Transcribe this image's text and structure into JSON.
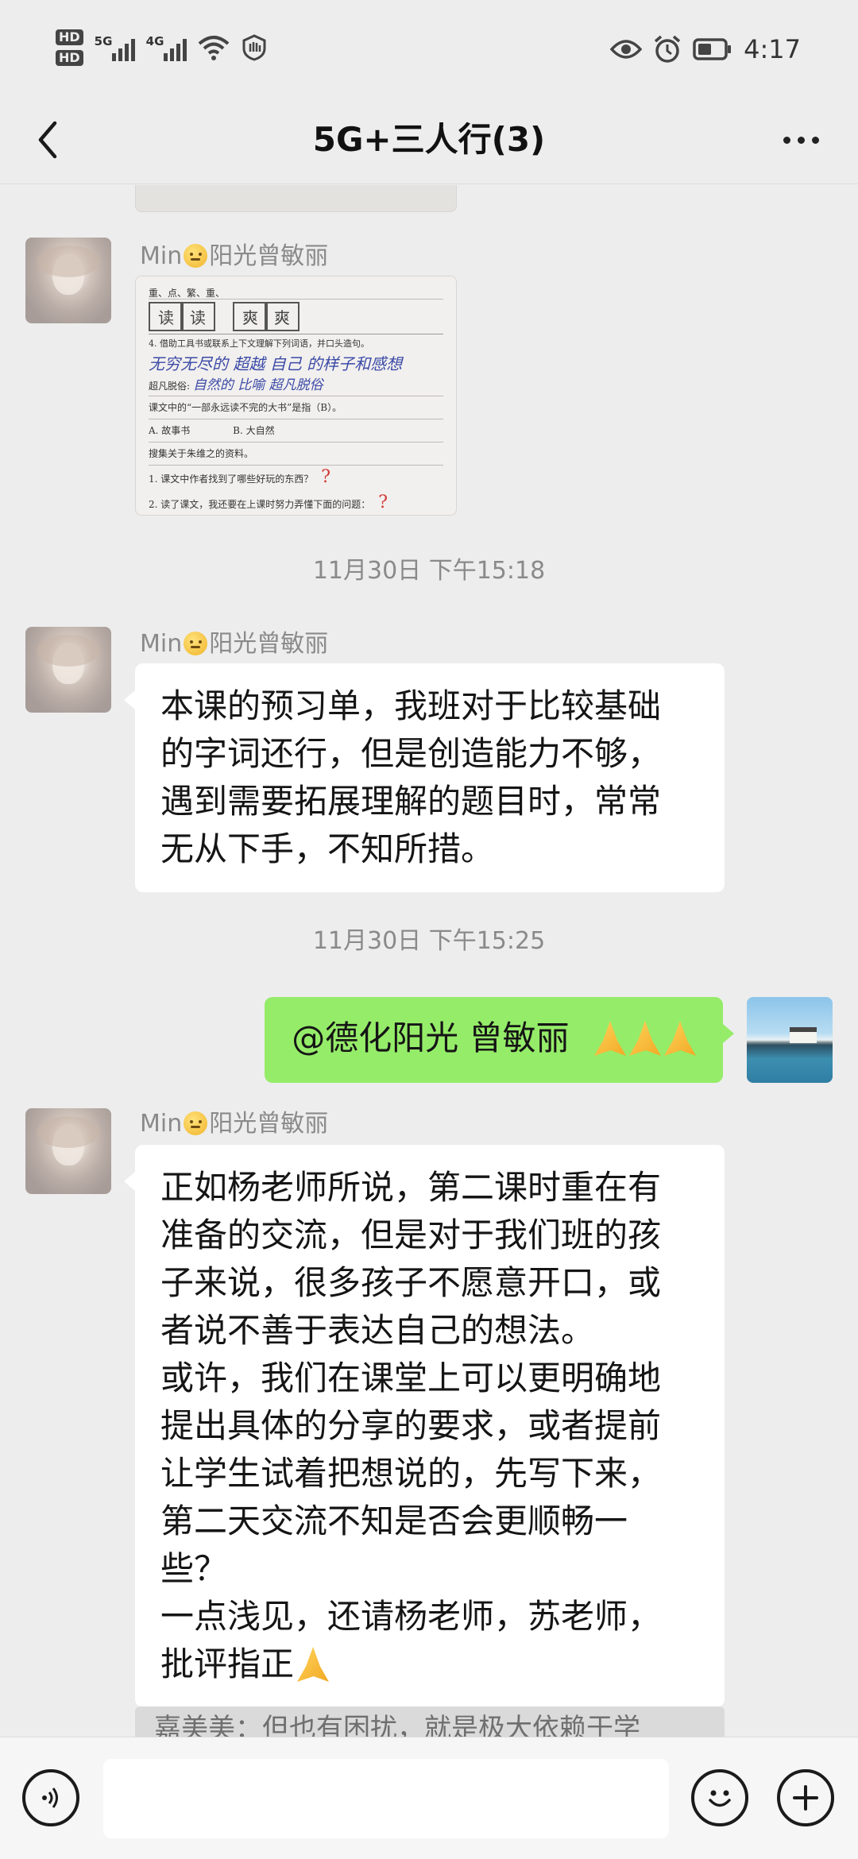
{
  "status_bar": {
    "hd1": "HD",
    "hd2": "HD",
    "net1": "5G",
    "net2": "4G",
    "time": "4:17"
  },
  "nav": {
    "title": "5G+三人行(3)"
  },
  "messages": [
    {
      "sender_prefix": "Min",
      "sender_name": "阳光曾敏丽",
      "worksheet": {
        "top_row": "重、点、繁、重、",
        "boxes": [
          "读",
          "读",
          "爽",
          "爽"
        ],
        "q4": "4. 借助工具书或联系上下文理解下列词语，并口头造句。",
        "q4_hand": "无穷无尽的 超越 自己 的样子和感想",
        "q4b": "超凡脱俗:",
        "q4b_hand": "自然的 比喻 超凡脱俗",
        "q5": "课文中的“一部永远读不完的大书”是指（B）。",
        "opt_a": "A. 故事书",
        "opt_b": "B. 大自然",
        "q6": "搜集关于朱维之的资料。",
        "q7": "1. 课文中作者找到了哪些好玩的东西？",
        "q8": "2. 读了课文，我还要在上课时努力弄懂下面的问题：",
        "mark": "?"
      }
    },
    {
      "timestamp": "11月30日 下午15:18"
    },
    {
      "sender_prefix": "Min",
      "sender_name": "阳光曾敏丽",
      "lines": [
        "本课的预习单，我班对于比较基础",
        "的字词还行，但是创造能力不够，",
        "遇到需要拓展理解的题目时，常常",
        "无从下手，不知所措。"
      ]
    },
    {
      "timestamp": "11月30日 下午15:25"
    },
    {
      "text": "@德化阳光 曾敏丽"
    },
    {
      "sender_prefix": "Min",
      "sender_name": "阳光曾敏丽",
      "lines": [
        "正如杨老师所说，第二课时重在有",
        "准备的交流，但是对于我们班的孩",
        "子来说，很多孩子不愿意开口，或",
        "者说不善于表达自己的想法。",
        "或许，我们在课堂上可以更明确地",
        "提出具体的分享的要求，或者提前",
        "让学生试着把想说的，先写下来，",
        "第二天交流不知是否会更顺畅一",
        "些？",
        "一点浅见，还请杨老师，苏老师，",
        "批评指正"
      ]
    }
  ],
  "quote_preview": "嘉美美：但也有困扰，就是极大依赖于学",
  "input": {
    "placeholder": ""
  },
  "icons": {
    "back": "back-arrow-icon",
    "more": "more-dots-icon",
    "voice": "voice-icon",
    "emoji": "emoji-icon",
    "plus": "plus-icon"
  },
  "colors": {
    "background": "#ededed",
    "incoming_bubble": "#ffffff",
    "outgoing_bubble": "#95ec69",
    "meta_text": "#8a8a8a"
  }
}
